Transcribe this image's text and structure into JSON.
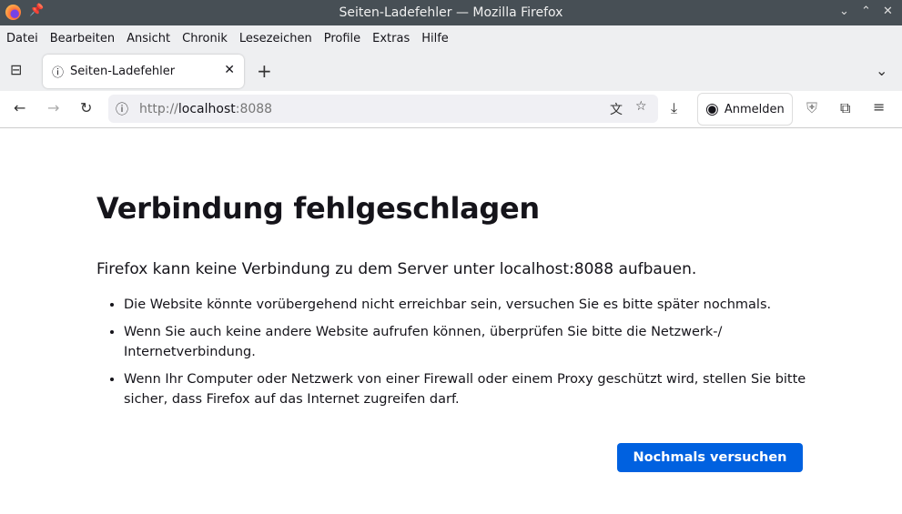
{
  "window": {
    "title": "Seiten-Ladefehler — Mozilla Firefox"
  },
  "menu": [
    "Datei",
    "Bearbeiten",
    "Ansicht",
    "Chronik",
    "Lesezeichen",
    "Profile",
    "Extras",
    "Hilfe"
  ],
  "tab": {
    "label": "Seiten-Ladefehler"
  },
  "url": {
    "scheme": "http://",
    "host": "localhost",
    "port": ":8088"
  },
  "toolbar": {
    "signin": "Anmelden"
  },
  "error": {
    "title": "Verbindung fehlgeschlagen",
    "lead": "Firefox kann keine Verbindung zu dem Server unter localhost:8088 aufbauen.",
    "items": [
      "Die Website könnte vorübergehend nicht erreichbar sein, versuchen Sie es bitte später nochmals.",
      "Wenn Sie auch keine andere Website aufrufen können, überprüfen Sie bitte die Netzwerk-/ Internetverbindung.",
      "Wenn Ihr Computer oder Netzwerk von einer Firewall oder einem Proxy geschützt wird, stellen Sie bitte sicher, dass Firefox auf das Internet zugreifen darf."
    ],
    "retry": "Nochmals versuchen"
  }
}
